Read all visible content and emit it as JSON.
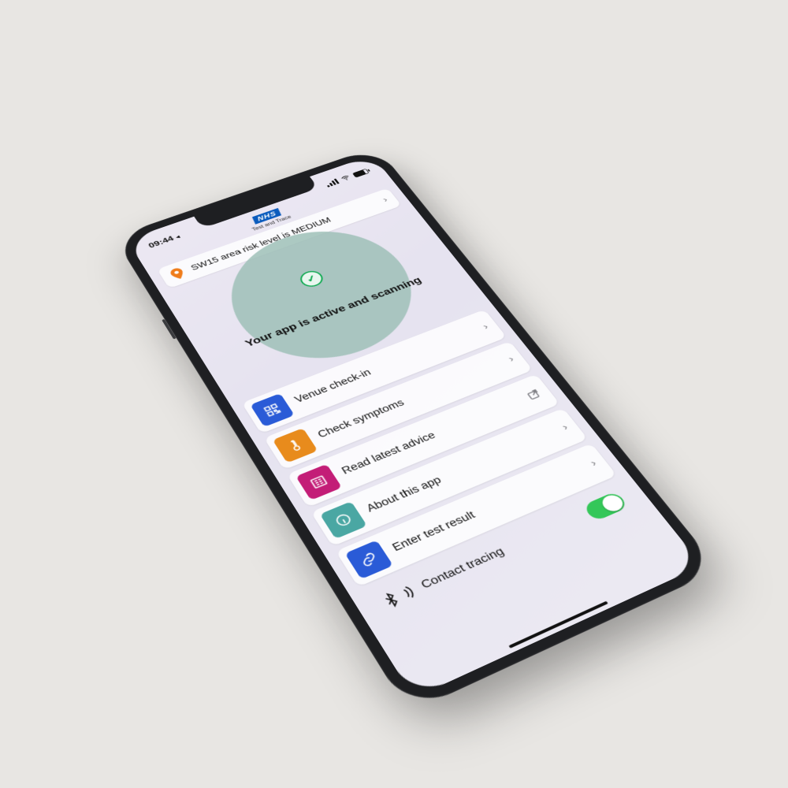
{
  "statusbar": {
    "time": "09:44"
  },
  "header": {
    "brand": "NHS",
    "sub": "Test and Trace"
  },
  "risk": {
    "text": "SW15 area risk level is MEDIUM"
  },
  "status": {
    "text": "Your app is active and scanning"
  },
  "menu": [
    {
      "label": "Venue check-in",
      "icon": "qr-icon",
      "tile": "t-blue",
      "trailing": "chev"
    },
    {
      "label": "Check symptoms",
      "icon": "therm-icon",
      "tile": "t-orange",
      "trailing": "chev"
    },
    {
      "label": "Read latest advice",
      "icon": "news-icon",
      "tile": "t-pink",
      "trailing": "ext"
    },
    {
      "label": "About this app",
      "icon": "info-icon",
      "tile": "t-teal",
      "trailing": "chev"
    },
    {
      "label": "Enter test result",
      "icon": "link-icon",
      "tile": "t-blue2",
      "trailing": "chev"
    }
  ],
  "tracing": {
    "label": "Contact tracing",
    "on": true
  }
}
